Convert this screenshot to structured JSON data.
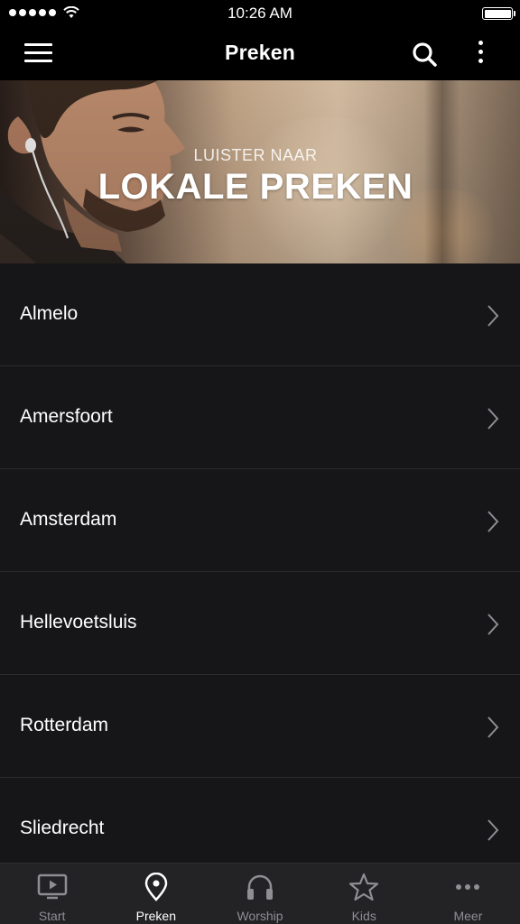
{
  "status_bar": {
    "time": "10:26 AM"
  },
  "nav": {
    "title": "Preken",
    "icons": [
      "menu-icon",
      "search-icon",
      "more-vertical-icon"
    ]
  },
  "hero": {
    "subtitle": "LUISTER NAAR",
    "title": "LOKALE PREKEN"
  },
  "cities": [
    {
      "label": "Almelo"
    },
    {
      "label": "Amersfoort"
    },
    {
      "label": "Amsterdam"
    },
    {
      "label": "Hellevoetsluis"
    },
    {
      "label": "Rotterdam"
    },
    {
      "label": "Sliedrecht"
    }
  ],
  "tabs": [
    {
      "label": "Start",
      "icon": "tv-play-icon",
      "active": false
    },
    {
      "label": "Preken",
      "icon": "location-pin-icon",
      "active": true
    },
    {
      "label": "Worship",
      "icon": "headphones-icon",
      "active": false
    },
    {
      "label": "Kids",
      "icon": "star-icon",
      "active": false
    },
    {
      "label": "Meer",
      "icon": "more-horizontal-icon",
      "active": false
    }
  ],
  "colors": {
    "background": "#161618",
    "bar": "#000000",
    "tab_bar": "#232325",
    "inactive": "#8e8e93",
    "active": "#ffffff"
  }
}
